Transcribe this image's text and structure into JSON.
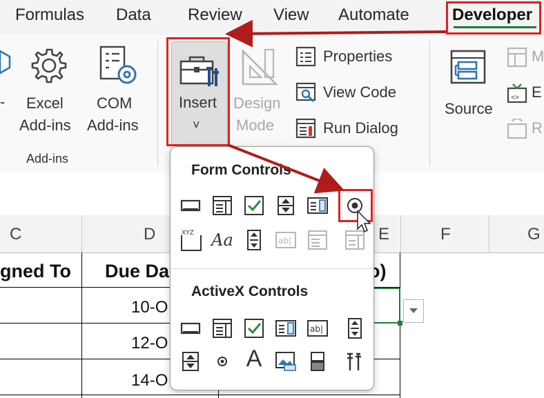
{
  "tabs": [
    {
      "id": "formulas",
      "label": "Formulas"
    },
    {
      "id": "data",
      "label": "Data"
    },
    {
      "id": "review",
      "label": "Review"
    },
    {
      "id": "view",
      "label": "View"
    },
    {
      "id": "automate",
      "label": "Automate"
    },
    {
      "id": "developer",
      "label": "Developer"
    }
  ],
  "ribbon": {
    "excel_addins": {
      "line1": "Excel",
      "line2": "Add-ins"
    },
    "com_addins": {
      "line1": "COM",
      "line2": "Add-ins"
    },
    "addins_group_label": "Add-ins",
    "insert": {
      "label": "Insert",
      "chevron": "˅"
    },
    "design_mode": {
      "line1": "Design",
      "line2": "Mode"
    },
    "properties": "Properties",
    "view_code": "View Code",
    "run_dialog": "Run Dialog",
    "source": "Source",
    "partial_m": "M",
    "partial_e": "E",
    "partial_r": "R",
    "partial_dash": "-"
  },
  "columns": [
    "C",
    "D",
    "E",
    "F",
    "G"
  ],
  "sheet": {
    "header_assigned": "gned To",
    "header_due": "Due Da",
    "header_e_partial": "o)",
    "rows": [
      "10-O",
      "12-O",
      "14-O"
    ]
  },
  "dropdown": {
    "form_title": "Form Controls",
    "activex_title": "ActiveX Controls",
    "form_controls": [
      "button-icon",
      "combo-box-icon",
      "check-box-icon",
      "spin-button-icon",
      "list-box-icon",
      "option-button-icon",
      "group-box-icon",
      "label-icon",
      "scroll-bar-icon",
      "text-field-icon",
      "combo-list-edit-icon",
      "combo-drop-down-edit-icon"
    ],
    "label_sample": "Aa",
    "group_sample": "XYZ",
    "activex_controls": [
      "command-button-icon",
      "combo-box-icon",
      "check-box-icon",
      "list-box-icon",
      "text-box-icon",
      "scroll-bar-icon",
      "spin-button-icon",
      "option-button-icon",
      "label-icon",
      "image-icon",
      "toggle-button-icon",
      "more-controls-icon"
    ],
    "activex_label_sample": "A"
  },
  "colors": {
    "highlight": "#e02020",
    "arrow": "#b01c1c",
    "accent_green": "#1f7a3a"
  }
}
